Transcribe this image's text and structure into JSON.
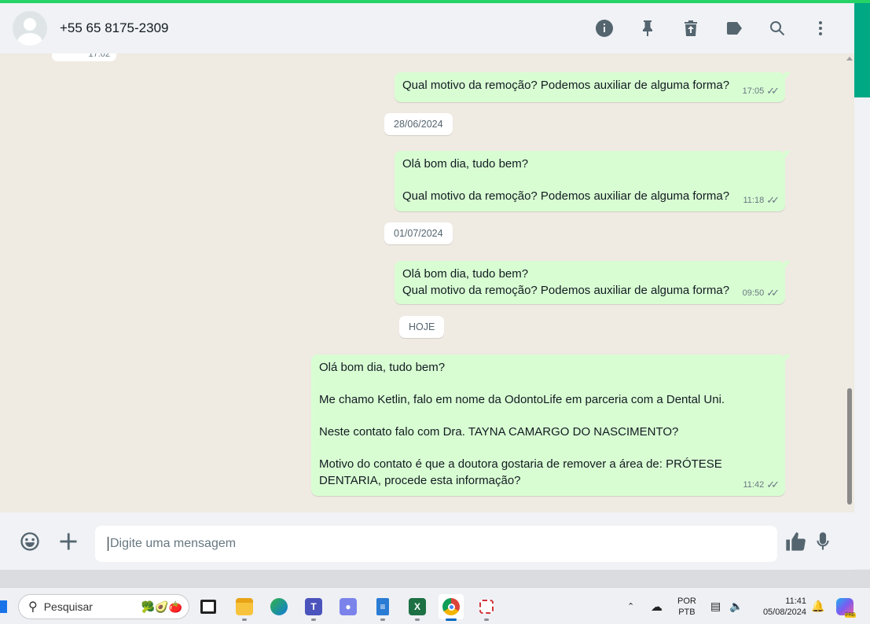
{
  "header": {
    "contact_name": "+55 65 8175-2309",
    "icons": [
      "info-icon",
      "pin-icon",
      "delete-icon",
      "label-icon",
      "search-icon",
      "menu-icon"
    ]
  },
  "chat": {
    "old_time": "17:02",
    "messages": [
      {
        "text": "Qual motivo da remoção? Podemos auxiliar de alguma forma?",
        "time": "17:05"
      },
      {
        "text": "Olá bom dia, tudo bem?\n\nQual motivo da remoção? Podemos auxiliar de alguma forma?",
        "time": "11:18"
      },
      {
        "text": "Olá bom dia, tudo bem?\nQual motivo da remoção? Podemos auxiliar de alguma forma?",
        "time": "09:50"
      },
      {
        "text": "Olá bom dia, tudo bem?\n\nMe chamo Ketlin, falo em nome da OdontoLife em parceria com a Dental Uni.\n\nNeste contato falo com Dra. TAYNA CAMARGO DO NASCIMENTO?\n\nMotivo do contato é que a doutora gostaria de remover a área de: PRÓTESE DENTARIA, procede esta informação?",
        "time": "11:42"
      }
    ],
    "dates": [
      "28/06/2024",
      "01/07/2024",
      "HOJE"
    ],
    "ticks": "✓✓"
  },
  "composer": {
    "placeholder": "Digite uma mensagem"
  },
  "taskbar": {
    "search_label": "Pesquisar",
    "search_deco": "🥦🥑🍅",
    "lang_top": "POR",
    "lang_bottom": "PTB",
    "time": "11:41",
    "date": "05/08/2024",
    "copilot_badge": "PRE"
  }
}
